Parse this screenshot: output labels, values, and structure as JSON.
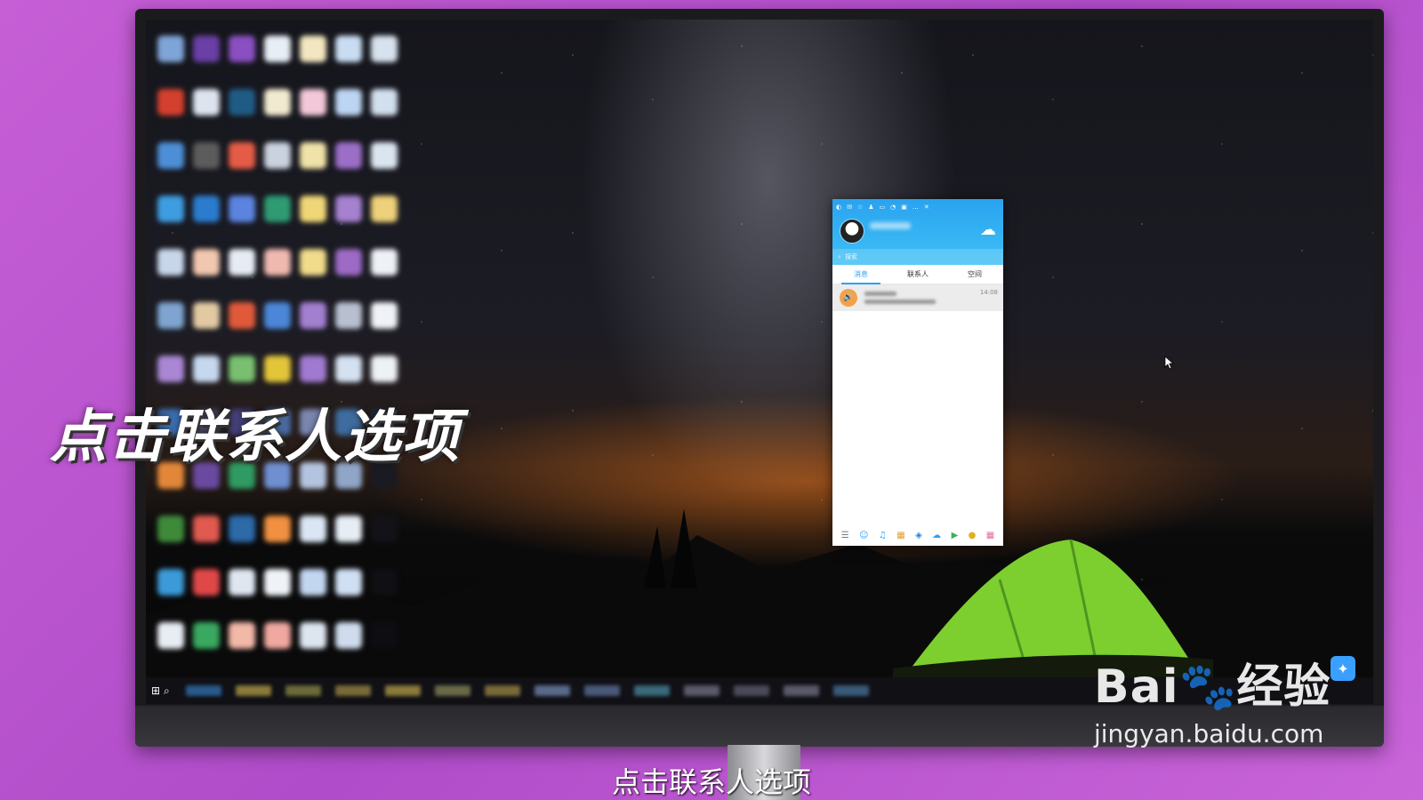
{
  "caption": {
    "big": "点击联系人选项",
    "bottom": "点击联系人选项"
  },
  "watermark": {
    "brand": "Bai",
    "brand2": "经验",
    "url": "jingyan.baidu.com"
  },
  "qq": {
    "search_placeholder": "搜索",
    "tabs": [
      "消息",
      "联系人",
      "空间"
    ],
    "message": {
      "time": "14:08"
    }
  },
  "colors": {
    "background": "#c65fd6",
    "qq_blue": "#2aa3f0",
    "message_icon": "#f4a24a"
  },
  "icons": {
    "windows": "windows-start-icon",
    "search": "search-icon",
    "weather": "weather-cloud-icon",
    "speaker": "speaker-icon"
  }
}
